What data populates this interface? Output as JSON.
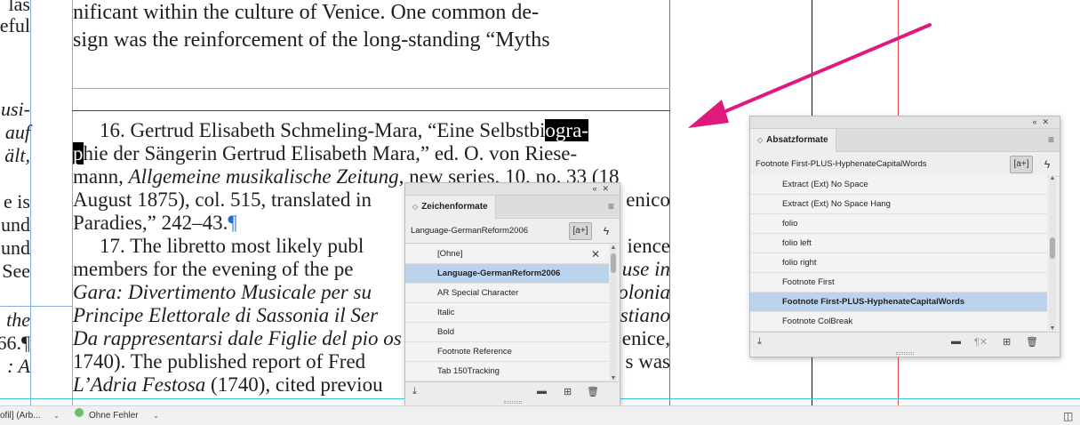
{
  "document": {
    "left_column_lines": [
      {
        "text": "las",
        "italic": false
      },
      {
        "text": "eful",
        "italic": false
      },
      {
        "text": "usi-",
        "italic": true
      },
      {
        "text": "auf",
        "italic": true
      },
      {
        "text": "ält,",
        "italic": true
      },
      {
        "text": "e is",
        "italic": false
      },
      {
        "text": "und",
        "italic": false
      },
      {
        "text": "und",
        "italic": false
      },
      {
        "text": "See",
        "italic": false
      },
      {
        "text": "the",
        "italic": true
      },
      {
        "text": "66.¶",
        "italic": false
      },
      {
        "text": ": A",
        "italic": true
      }
    ],
    "body_lines": [
      "nificant within the culture of Venice. One common de-",
      "sign was the reinforcement of the long-standing “Myths"
    ],
    "footnote16": {
      "line1_before": "16. Gertrud Elisabeth Schmeling-Mara, “Eine Selbstbi",
      "line1_selected": "ogra-",
      "line2_selected": "p",
      "line2_after": "hie der Sängerin Gertrud Elisabeth Mara,” ed. O. von Riese-",
      "line3_before": "mann, ",
      "line3_italic": "Allgemeine musikalische Zeitung",
      "line3_after": ", new series, 10, no. 33 (18",
      "line4_left": "August 1875), col. 515, translated in",
      "line4_right": "enico",
      "line5": "Paradies,” 242–43.",
      "pilcrow": "¶"
    },
    "footnote17": {
      "line1_left": "17. The libretto most likely publ",
      "line1_right": "ience",
      "line2_left": "members for the evening of the pe",
      "line2_right_italic": "use in",
      "line3_left_italic": "Gara: Divertimento Musicale per su",
      "line3_right_italic": "olonia",
      "line4_left_italic": "Principe Elettorale di Sassonia il Ser",
      "line4_right_italic": "stiano",
      "line5_left_italic": "Da rappresentarsi dale Figlie del pio os",
      "line5_right": "enice,",
      "line6_left": "1740). The published report of Fred",
      "line6_right": "s was",
      "line7_italic": "L’Adria Festosa",
      "line7_rest": " (1740), cited previou"
    }
  },
  "zeichenformate_panel": {
    "tab_label": "Zeichenformate",
    "current_style": "Language-GermanReform2006",
    "new_from_label": "[a+]",
    "items": [
      {
        "label": "[Ohne]",
        "selected": false,
        "has_x": true
      },
      {
        "label": "Language-GermanReform2006",
        "selected": true,
        "has_x": false
      },
      {
        "label": "AR Special Character",
        "selected": false,
        "has_x": false
      },
      {
        "label": "Italic",
        "selected": false,
        "has_x": false
      },
      {
        "label": "Bold",
        "selected": false,
        "has_x": false
      },
      {
        "label": "Footnote Reference",
        "selected": false,
        "has_x": false
      },
      {
        "label": "Tab 150Tracking",
        "selected": false,
        "has_x": false
      }
    ]
  },
  "absatzformate_panel": {
    "tab_label": "Absatzformate",
    "current_style": "Footnote First-PLUS-HyphenateCapitalWords",
    "new_from_label": "[a+]",
    "items": [
      {
        "label": "Extract (Ext) No Space",
        "selected": false
      },
      {
        "label": "Extract (Ext) No Space Hang",
        "selected": false
      },
      {
        "label": "folio",
        "selected": false
      },
      {
        "label": "folio left",
        "selected": false
      },
      {
        "label": "folio right",
        "selected": false
      },
      {
        "label": "Footnote First",
        "selected": false
      },
      {
        "label": "Footnote First-PLUS-HyphenateCapitalWords",
        "selected": true
      },
      {
        "label": "Footnote ColBreak",
        "selected": false
      }
    ]
  },
  "statusbar": {
    "profile_text": "ofil] (Arb...",
    "preflight_text": "Ohne Fehler"
  },
  "colors": {
    "arrow": "#e0197d",
    "selection_bg": "#bcd3ee",
    "guide_cyan": "#3ec9d6",
    "guide_magenta": "#c040c0",
    "guide_red": "#e04848",
    "guide_blue": "#7fb0e0",
    "preflight_ok": "#6bbf6b"
  }
}
